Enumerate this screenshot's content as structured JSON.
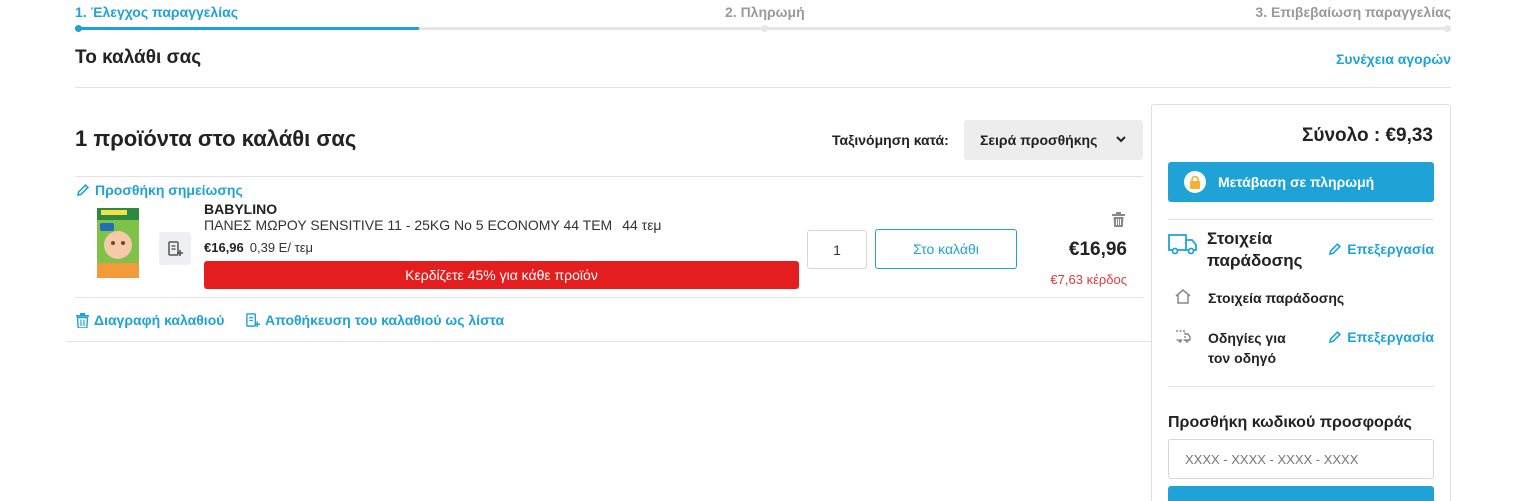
{
  "steps": [
    {
      "label": "1. Έλεγχος παραγγελίας"
    },
    {
      "label": "2. Πληρωμή"
    },
    {
      "label": "3. Επιβεβαίωση παραγγελίας"
    }
  ],
  "header": {
    "title": "Το καλάθι σας",
    "continue_shopping": "Συνέχεια αγορών"
  },
  "cart": {
    "count_title": "1 προϊόντα στο καλάθι σας",
    "sort_label": "Ταξινόμηση κατά:",
    "sort_value": "Σειρά προσθήκης",
    "add_note": "Προσθήκη σημείωσης",
    "item": {
      "brand": "BABYLINO",
      "name": "ΠΑΝΕΣ ΜΩΡΟΥ SENSITIVE 11 - 25KG No 5 ECONOMY 44 TEM",
      "pack_qty": "44 τεμ",
      "price": "€16,96",
      "unit_price": "0,39 E/ τεμ",
      "promo": "Κερδίζετε 45% για κάθε προϊόν",
      "quantity": "1",
      "to_cart": "Στο καλάθι",
      "line_total": "€16,96",
      "savings": "€7,63 κέρδος"
    },
    "delete_cart": "Διαγραφή καλαθιού",
    "save_as_list": "Αποθήκευση του καλαθιού ως λίστα"
  },
  "summary": {
    "total": "Σύνολο : €9,33",
    "checkout": "Μετάβαση σε πληρωμή",
    "delivery_title": "Στοιχεία παράδοσης",
    "edit": "Επεξεργασία",
    "delivery_sub": "Στοιχεία παράδοσης",
    "driver_instructions": "Οδηγίες για τον οδηγό",
    "coupon_title": "Προσθήκη κωδικού προσφοράς",
    "coupon_placeholder": "XXXX - XXXX - XXXX - XXXX"
  },
  "colors": {
    "accent": "#1fa3d6",
    "promo": "#e41e1e",
    "savings": "#e03a3a"
  }
}
